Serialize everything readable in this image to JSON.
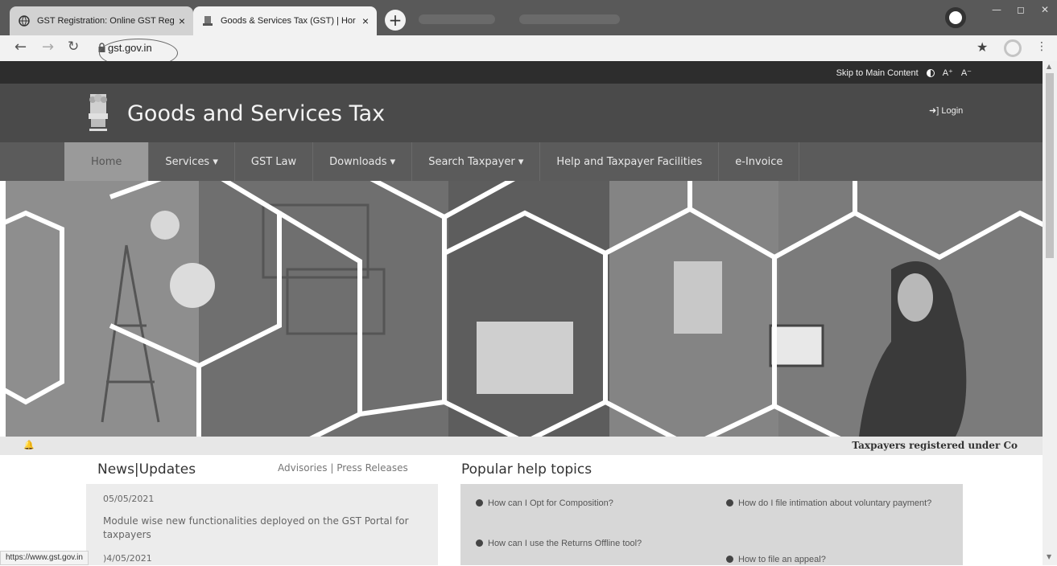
{
  "browser": {
    "tabs": [
      {
        "title": "GST Registration: Online GST Reg",
        "close": "×"
      },
      {
        "title": "Goods & Services Tax (GST) | Hor",
        "close": "×"
      }
    ],
    "new_tab": "+",
    "url": "gst.gov.in",
    "status_url": "https://www.gst.gov.in"
  },
  "top_strip": {
    "skip": "Skip to Main Content",
    "font_increase": "A⁺",
    "font_decrease": "A⁻"
  },
  "header": {
    "title": "Goods and Services Tax",
    "login": "Login"
  },
  "nav": [
    {
      "label": "Home",
      "name": "nav-home",
      "active": true
    },
    {
      "label": "Services ▾",
      "name": "nav-services"
    },
    {
      "label": "GST Law",
      "name": "nav-gst-law"
    },
    {
      "label": "Downloads ▾",
      "name": "nav-downloads"
    },
    {
      "label": "Search Taxpayer ▾",
      "name": "nav-search-taxpayer"
    },
    {
      "label": "Help and Taxpayer Facilities",
      "name": "nav-help"
    },
    {
      "label": "e-Invoice",
      "name": "nav-e-invoice"
    }
  ],
  "ticker": "Taxpayers registered under Co",
  "news": {
    "title": "News|Updates",
    "links": "Advisories | Press Releases",
    "items": [
      {
        "date": "05/05/2021",
        "text": "Module wise new functionalities deployed on the GST Portal for taxpayers"
      },
      {
        "date": ")4/05/2021"
      }
    ]
  },
  "help": {
    "title": "Popular help topics",
    "items": [
      "How can I Opt for Composition?",
      "How do I file intimation about voluntary payment?",
      "How can I use the Returns Offline tool?",
      "How to file an appeal?"
    ]
  },
  "colors": {
    "header": "#4a4a4a",
    "top_strip": "#2d2d2d",
    "menu": "#5b5b5b",
    "menu_active": "#9a9a9a",
    "news_box": "#ececec",
    "help_box": "#d7d7d7"
  }
}
